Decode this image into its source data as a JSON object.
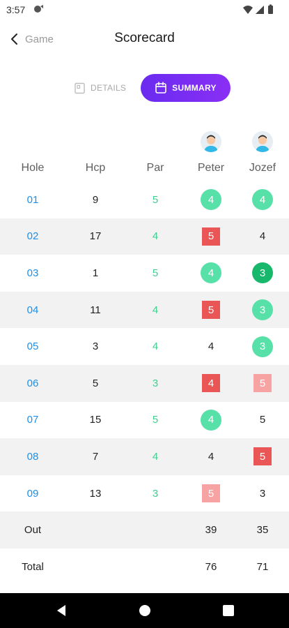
{
  "status_bar": {
    "time": "3:57"
  },
  "header": {
    "back_label": "Game",
    "title": "Scorecard"
  },
  "tabs": [
    {
      "label": "DETAILS",
      "icon": "document-icon",
      "active": false
    },
    {
      "label": "SUMMARY",
      "icon": "calendar-icon",
      "active": true
    }
  ],
  "table": {
    "columns": [
      "Hole",
      "Hcp",
      "Par",
      "Peter",
      "Jozef"
    ],
    "rows": [
      {
        "hole": "01",
        "hcp": "9",
        "par": "5",
        "peter": "4",
        "peter_style": "circle-light",
        "jozef": "4",
        "jozef_style": "circle-light"
      },
      {
        "hole": "02",
        "hcp": "17",
        "par": "4",
        "peter": "5",
        "peter_style": "square-red",
        "jozef": "4",
        "jozef_style": "plain"
      },
      {
        "hole": "03",
        "hcp": "1",
        "par": "5",
        "peter": "4",
        "peter_style": "circle-light",
        "jozef": "3",
        "jozef_style": "circle-dark"
      },
      {
        "hole": "04",
        "hcp": "11",
        "par": "4",
        "peter": "5",
        "peter_style": "square-red",
        "jozef": "3",
        "jozef_style": "circle-light"
      },
      {
        "hole": "05",
        "hcp": "3",
        "par": "4",
        "peter": "4",
        "peter_style": "plain",
        "jozef": "3",
        "jozef_style": "circle-light"
      },
      {
        "hole": "06",
        "hcp": "5",
        "par": "3",
        "peter": "4",
        "peter_style": "square-red",
        "jozef": "5",
        "jozef_style": "square-pink"
      },
      {
        "hole": "07",
        "hcp": "15",
        "par": "5",
        "peter": "4",
        "peter_style": "circle-light",
        "jozef": "5",
        "jozef_style": "plain"
      },
      {
        "hole": "08",
        "hcp": "7",
        "par": "4",
        "peter": "4",
        "peter_style": "plain",
        "jozef": "5",
        "jozef_style": "square-red"
      },
      {
        "hole": "09",
        "hcp": "13",
        "par": "3",
        "peter": "5",
        "peter_style": "square-pink",
        "jozef": "3",
        "jozef_style": "plain"
      }
    ],
    "out": {
      "label": "Out",
      "peter": "39",
      "jozef": "35"
    },
    "total": {
      "label": "Total",
      "peter": "76",
      "jozef": "71"
    }
  },
  "colors": {
    "accent": "#7a2df2",
    "hole_link": "#1f8fe6",
    "par_green": "#3fcf8e",
    "birdie_light": "#57e0a8",
    "eagle_dark": "#17b76c",
    "bogey_red": "#ea5555",
    "bogey_pink": "#f7a3a3"
  }
}
